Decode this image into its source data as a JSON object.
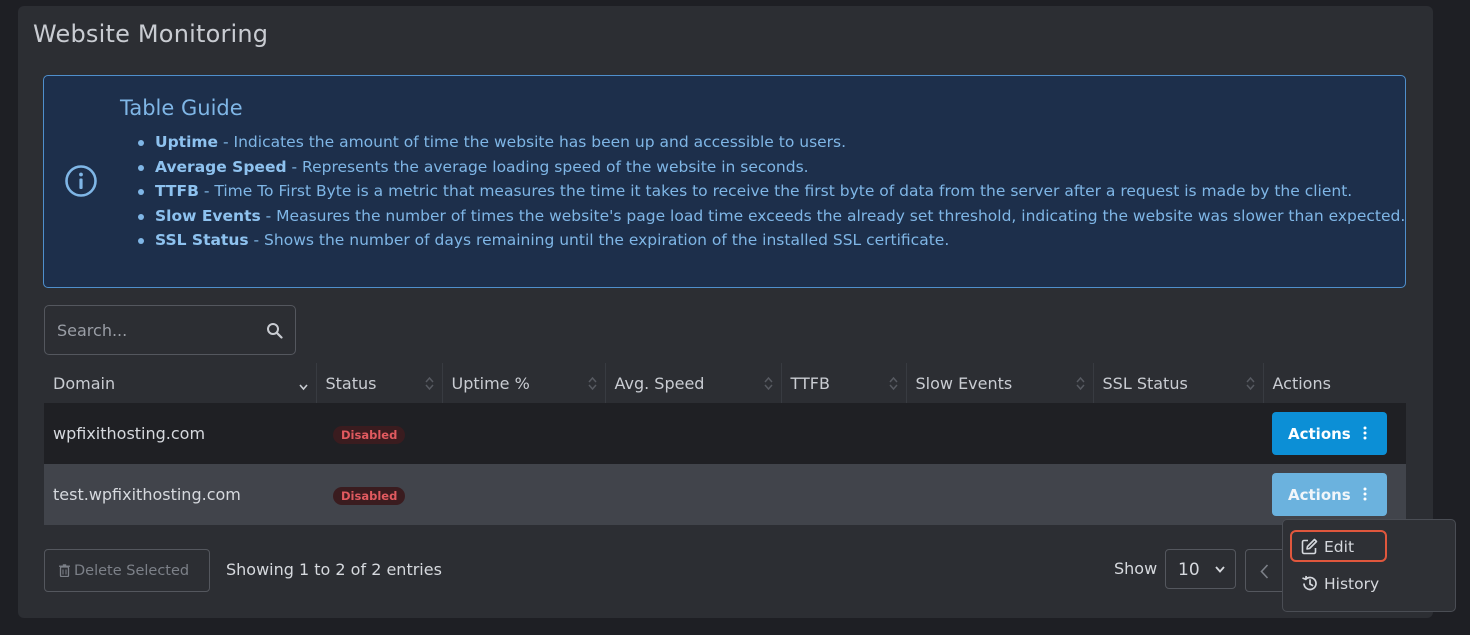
{
  "page": {
    "title": "Website Monitoring"
  },
  "guide": {
    "title": "Table Guide",
    "items": [
      {
        "term": "Uptime",
        "desc": " - Indicates the amount of time the website has been up and accessible to users."
      },
      {
        "term": "Average Speed",
        "desc": " - Represents the average loading speed of the website in seconds."
      },
      {
        "term": "TTFB",
        "desc": " - Time To First Byte is a metric that measures the time it takes to receive the first byte of data from the server after a request is made by the client."
      },
      {
        "term": "Slow Events",
        "desc": " - Measures the number of times the website's page load time exceeds the already set threshold, indicating the website was slower than expected."
      },
      {
        "term": "SSL Status",
        "desc": " - Shows the number of days remaining until the expiration of the installed SSL certificate."
      }
    ]
  },
  "search": {
    "placeholder": "Search..."
  },
  "table": {
    "columns": [
      "Domain",
      "Status",
      "Uptime %",
      "Avg. Speed",
      "TTFB",
      "Slow Events",
      "SSL Status",
      "Actions"
    ],
    "rows": [
      {
        "domain": "wpfixithosting.com",
        "status": "Disabled",
        "uptime": "",
        "avg_speed": "",
        "ttfb": "",
        "slow_events": "",
        "ssl_status": "",
        "action_label": "Actions"
      },
      {
        "domain": "test.wpfixithosting.com",
        "status": "Disabled",
        "uptime": "",
        "avg_speed": "",
        "ttfb": "",
        "slow_events": "",
        "ssl_status": "",
        "action_label": "Actions"
      }
    ]
  },
  "footer": {
    "delete_label": "Delete Selected",
    "showing": "Showing 1 to 2 of 2 entries",
    "show_label": "Show",
    "page_size": "10"
  },
  "dropdown": {
    "items": [
      {
        "label": "Edit",
        "icon": "edit-icon"
      },
      {
        "label": "History",
        "icon": "history-icon"
      }
    ]
  },
  "colors": {
    "accent": "#0c8fd6",
    "guide_bg": "#1d2f4b",
    "guide_text": "#7fb6e6",
    "badge_text": "#e05a5f",
    "highlight": "#e0573d"
  }
}
